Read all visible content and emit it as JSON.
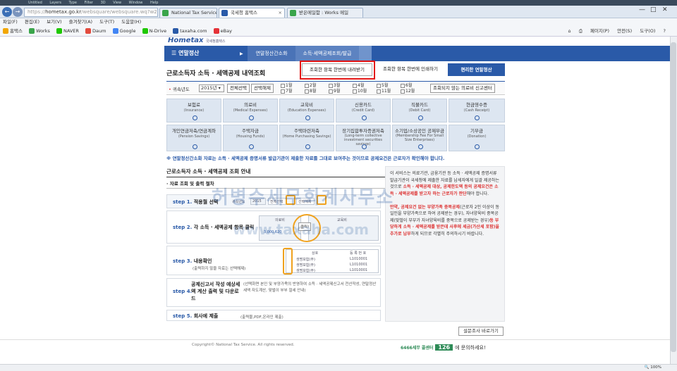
{
  "os_bar": [
    "Untitled",
    "Layers",
    "Type",
    "Filter",
    "3D",
    "View",
    "Window",
    "Help"
  ],
  "browser": {
    "url_prefix": "https://",
    "url_domain": "hometax.go.kr",
    "url_path": "/websquare/websquare.wq?w2xPath=/ui/pp/index.xml",
    "tabs": [
      {
        "label": "National Tax Service [KR]",
        "color": "#3aa54b"
      },
      {
        "label": "국세청 홈택스",
        "color": "#2a5aa8"
      },
      {
        "label": "받은메일함 : Works 메일",
        "color": "#3aa54b"
      }
    ]
  },
  "menubar": [
    "파일(F)",
    "편집(E)",
    "보기(V)",
    "즐겨찾기(A)",
    "도구(T)",
    "도움말(H)"
  ],
  "favorites": [
    {
      "label": "홈택스",
      "color": "#f2a600"
    },
    {
      "label": "Works",
      "color": "#3aa54b"
    },
    {
      "label": "NAVER",
      "color": "#1ec800"
    },
    {
      "label": "Daum",
      "color": "#e34b3e"
    },
    {
      "label": "Google",
      "color": "#4285f4"
    },
    {
      "label": "N-Drive",
      "color": "#1ec800"
    },
    {
      "label": "taxaha.com",
      "color": "#2a5aa8"
    },
    {
      "label": "eBay",
      "color": "#e53238"
    }
  ],
  "toolbar_right": [
    "페이지(P)",
    "안전(S)",
    "도구(O)",
    "?"
  ],
  "site": {
    "logo": "Hometax",
    "logo_sub": "국세청홈택스",
    "gnb_title": "연말정산",
    "gnb_path": [
      "연말정산간소화",
      "소득·세액공제조회/발급"
    ]
  },
  "page": {
    "title": "근로소득자 소득 · 세액공제 내역조회",
    "btn_download": "조회한 항목 한번에 내려받기",
    "btn_print": "조회한 항목 한번에 인쇄하기",
    "btn_easy": "편리한 연말정산",
    "filter": {
      "label": "귀속년도",
      "year": "2015년",
      "btn_selall": "전체선택",
      "btn_clear": "선택해제",
      "months": [
        "1월",
        "2월",
        "3월",
        "4월",
        "5월",
        "6월",
        "7월",
        "8월",
        "9월",
        "10월",
        "11월",
        "12월"
      ],
      "btn_notice": "조회되지 않는 의료비 신고센터"
    },
    "categories": [
      {
        "ko": "보험료",
        "en": "(Insurance)"
      },
      {
        "ko": "의료비",
        "en": "(Medical Expenses)"
      },
      {
        "ko": "교육비",
        "en": "(Education Expenses)"
      },
      {
        "ko": "신용카드",
        "en": "(Credit Card)"
      },
      {
        "ko": "직불카드",
        "en": "(Debit Card)"
      },
      {
        "ko": "현금영수증",
        "en": "(Cash Receipt)"
      },
      {
        "ko": "개인연금저축/연금계좌",
        "en": "(Pension Savings)"
      },
      {
        "ko": "주택자금",
        "en": "(Housing Funds)"
      },
      {
        "ko": "주택마련저축",
        "en": "(Home Purchasing Savings)"
      },
      {
        "ko": "장기집합투자증권저축",
        "en": "(Long-term collective investment securities savings)"
      },
      {
        "ko": "소기업/소상공인 공제부금",
        "en": "(Membership Fee For Small Size Enterprises)"
      },
      {
        "ko": "기부금",
        "en": "(Donation)"
      }
    ],
    "notice": "※ 연말정산간소화 자료는 소득 · 세액공제 증명서류 발급기관이 제출한 자료를 그대로 보여주는 것이므로 공제요건은 근로자가 확인해야 합니다.",
    "guide_title": "근로소득자 소득 · 세액공제 조회 안내",
    "guide_sub": "· 자료 조회 및 출력 절차",
    "steps": [
      {
        "num": "step 1.",
        "title": "적용월 선택",
        "desc": ""
      },
      {
        "num": "step 2.",
        "title": "각 소득 · 세액공제 항목 클릭",
        "desc": ""
      },
      {
        "num": "step 3.",
        "title": "내용확인",
        "desc": "(출력하지 않을 자료는 선택해제)"
      },
      {
        "num": "step 4.",
        "title": "공제신고서 작성 예상세액 계산 출력 및 다운로드",
        "desc": "(선택화면 본인 및 부양가족의 반영하여 소득 · 세액공제신고서 전산작성, 연말정산 세액 자도계산, 맞벌이 부부 절세 안내)"
      },
      {
        "num": "step 5.",
        "title": "회사에 제출",
        "desc": "(출력물,PDF,온라인 제출)"
      }
    ],
    "step_mini": {
      "year_label": "귀속년도",
      "year": "2015",
      "selall": "전체선택",
      "clear": "선택해제",
      "med": "의료비",
      "edu": "교육비",
      "amount": "3,000,620",
      "click": "클릭!",
      "col1": "상호",
      "col2": "등 록 번 호",
      "row1": "생명보험(주)",
      "row2": "생명보험(주)",
      "row3": "생명보험(주)",
      "code": "L1010001"
    },
    "right_text": [
      {
        "t": "이 서비스는 의료기관, 금융기관 등 소득 · 세액공제 증명서류 발급기관이 국세청에 제출한 자료를 납세자에게 일괄 제공하는 것으로 ",
        "r": false
      },
      {
        "t": "소득 · 세액공제 대상, 공제한도액 등의 공제요건은 소득 · 세액공제를 받고자 하는 근로자가 판단",
        "r": true
      },
      {
        "t": "해야 합니다.",
        "r": false
      },
      {
        "t": "만약, 공제요건 없는 부양가족 중복공제",
        "r": true
      },
      {
        "t": "(근로자 2인 이상이 동일인을 부양가족으로 하여 공제받는 경우), 자녀양육비 중복공제(맞벌이 부부가 자녀양육비를 중복으로 공제받는 경우)",
        "r": false
      },
      {
        "t": "등 부당하게 소득 · 세액공제를 받은데 사후에 세금(가산세 포함)을 추가로 납부",
        "r": true
      },
      {
        "t": "하게 되므로 각별히 주의하시기 바랍니다.",
        "r": false
      }
    ],
    "btn_survey": "설문조사 바로가기",
    "copyright": "Copyright© National Tax Service. All rights reserved.",
    "callcenter_label": "6466세무 콜센터",
    "callcenter_num": "126",
    "callcenter_tail": "에 문의하세요!"
  },
  "watermark": {
    "line1": "허병수세무회계사무소",
    "line2": "www.taxaha.com"
  },
  "status": {
    "zoom": "100%"
  }
}
